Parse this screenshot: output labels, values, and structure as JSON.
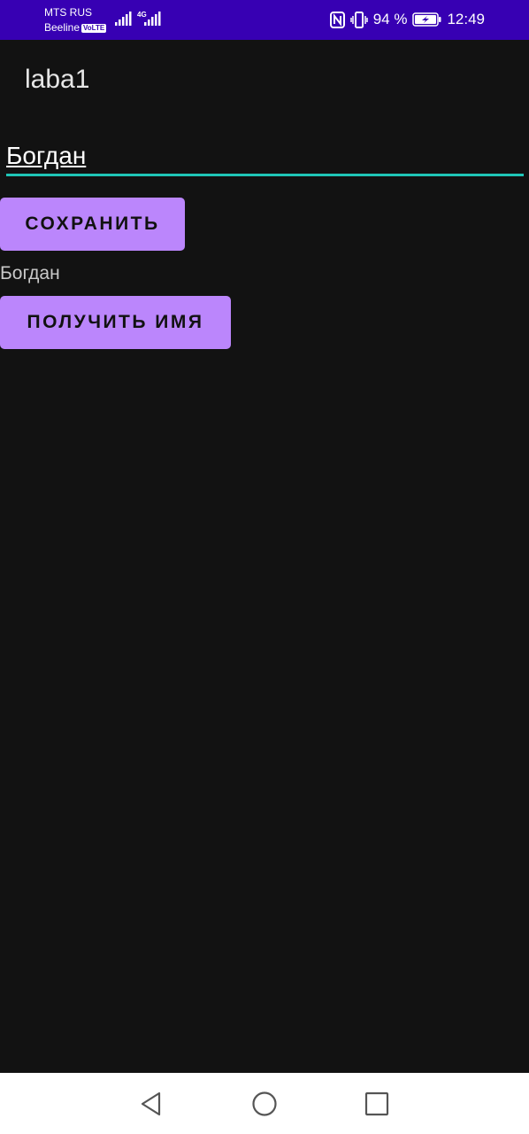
{
  "status_bar": {
    "carrier1": "MTS RUS",
    "carrier2": "Beeline",
    "volte": "VoLTE",
    "network_type": "4G",
    "battery_percent": "94 %",
    "time": "12:49",
    "bg_color": "#3700b3"
  },
  "app_bar": {
    "title": "laba1"
  },
  "form": {
    "name_value": "Богдан",
    "save_label": "СОХРАНИТЬ",
    "result_text": "Богдан",
    "get_name_label": "ПОЛУЧИТЬ ИМЯ"
  },
  "colors": {
    "background": "#121212",
    "button": "#bb86fc",
    "input_underline": "#1fc5b7"
  },
  "icons": {
    "nfc": "nfc-icon",
    "vibrate": "vibrate-icon",
    "battery": "battery-charging-icon",
    "back": "back-triangle-icon",
    "home": "home-circle-icon",
    "recents": "recents-square-icon"
  }
}
